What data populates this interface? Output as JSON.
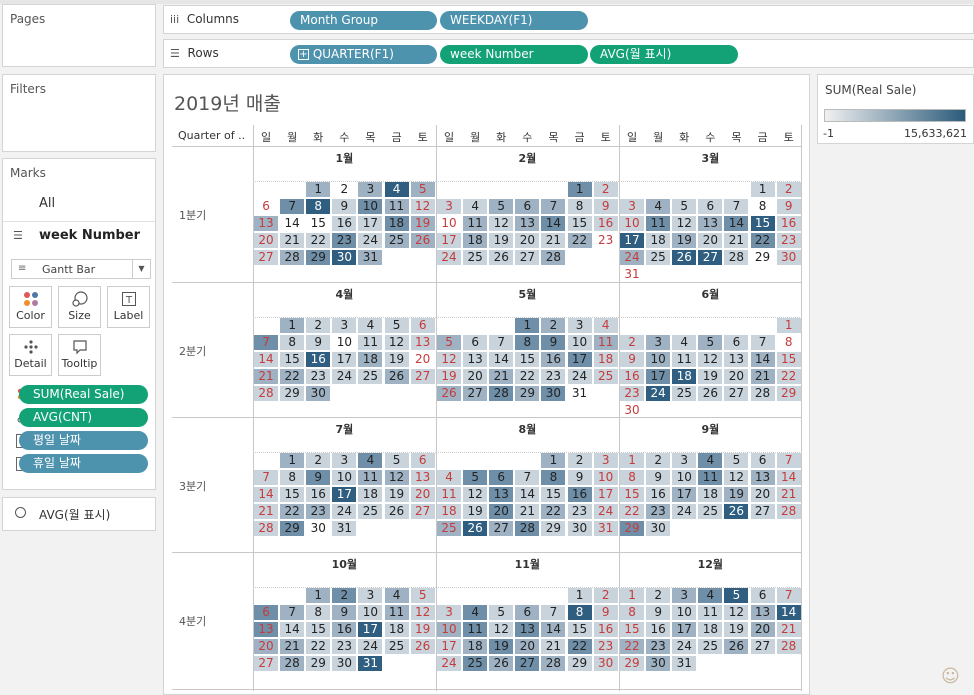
{
  "left_panel": {
    "pages_title": "Pages",
    "filters_title": "Filters",
    "marks_title": "Marks",
    "marks_all": "All",
    "marks_selected": "week Number",
    "mark_type": "Gantt Bar",
    "buttons": {
      "color": "Color",
      "size": "Size",
      "label": "Label",
      "detail": "Detail",
      "tooltip": "Tooltip"
    },
    "fields": [
      "SUM(Real Sale)",
      "AVG(CNT)",
      "평일 날짜",
      "휴일 날짜"
    ],
    "avg_field": "AVG(월 표시)"
  },
  "shelves": {
    "columns_label": "Columns",
    "rows_label": "Rows",
    "columns": [
      "Month Group",
      "WEEKDAY(F1)"
    ],
    "rows": [
      "QUARTER(F1)",
      "week Number",
      "AVG(월 표시)"
    ]
  },
  "view": {
    "title": "2019년 매출",
    "quarter_header": "Quarter of ..",
    "weekdays": [
      "일",
      "월",
      "화",
      "수",
      "목",
      "금",
      "토"
    ],
    "quarters": [
      "1분기",
      "2분기",
      "3분기",
      "4분기"
    ],
    "month_names": [
      "1월",
      "2월",
      "3월",
      "4월",
      "5월",
      "6월",
      "7월",
      "8월",
      "9월",
      "10월",
      "11월",
      "12월"
    ]
  },
  "legend": {
    "title": "SUM(Real Sale)",
    "min": "-1",
    "max": "15,633,621",
    "color_low": "#f0f0f0",
    "color_high": "#2b5b7b"
  },
  "colors": {
    "sunday_red": "#c63b3b",
    "pill_green": "#12a276",
    "pill_blue": "#4e93ad"
  },
  "month_shades": {
    "1": [
      0,
      0,
      2,
      0,
      2,
      4,
      2,
      0,
      3,
      4,
      1,
      3,
      2,
      1,
      2,
      0,
      0,
      1,
      1,
      3,
      2,
      1,
      1,
      1,
      3,
      1,
      2,
      2,
      1,
      2,
      3,
      4,
      2,
      0,
      0
    ],
    "2": [
      0,
      0,
      0,
      0,
      0,
      3,
      1,
      1,
      1,
      2,
      2,
      2,
      1,
      1,
      0,
      2,
      1,
      2,
      3,
      1,
      1,
      1,
      2,
      1,
      1,
      1,
      2,
      0,
      1,
      1,
      1,
      1,
      2,
      0,
      0
    ],
    "3": [
      0,
      0,
      0,
      0,
      0,
      1,
      1,
      1,
      2,
      1,
      1,
      1,
      0,
      1,
      1,
      3,
      1,
      2,
      3,
      4,
      1,
      4,
      1,
      2,
      1,
      1,
      3,
      1,
      2,
      1,
      4,
      4,
      1,
      0,
      1
    ],
    "4": [
      0,
      2,
      1,
      1,
      1,
      1,
      1,
      3,
      1,
      1,
      0,
      1,
      1,
      1,
      1,
      1,
      4,
      1,
      2,
      1,
      0,
      2,
      2,
      1,
      1,
      1,
      2,
      1,
      1,
      1,
      2,
      0,
      0,
      0,
      0
    ],
    "5": [
      0,
      0,
      0,
      3,
      2,
      1,
      1,
      2,
      1,
      1,
      3,
      3,
      1,
      2,
      1,
      1,
      1,
      1,
      2,
      3,
      1,
      1,
      1,
      2,
      1,
      1,
      1,
      1,
      2,
      2,
      3,
      2,
      3,
      0,
      0
    ],
    "6": [
      0,
      0,
      0,
      0,
      0,
      0,
      1,
      1,
      2,
      1,
      2,
      1,
      1,
      0,
      1,
      2,
      1,
      1,
      1,
      2,
      1,
      1,
      3,
      4,
      1,
      1,
      2,
      1,
      1,
      4,
      1,
      1,
      1,
      1,
      1
    ],
    "7": [
      0,
      2,
      1,
      1,
      3,
      1,
      1,
      1,
      1,
      3,
      1,
      2,
      2,
      1,
      1,
      1,
      1,
      4,
      1,
      1,
      1,
      1,
      2,
      2,
      1,
      1,
      1,
      1,
      1,
      3,
      0,
      1,
      0,
      0,
      0
    ],
    "8": [
      0,
      0,
      0,
      0,
      2,
      1,
      1,
      1,
      3,
      3,
      1,
      3,
      1,
      1,
      1,
      1,
      3,
      1,
      1,
      3,
      1,
      1,
      1,
      3,
      1,
      2,
      1,
      1,
      2,
      4,
      2,
      3,
      1,
      1,
      1
    ],
    "9": [
      1,
      1,
      1,
      3,
      1,
      1,
      1,
      1,
      1,
      1,
      3,
      1,
      2,
      1,
      1,
      1,
      2,
      1,
      2,
      1,
      1,
      1,
      2,
      1,
      1,
      4,
      1,
      1,
      3,
      1,
      0,
      0,
      0,
      0,
      0
    ],
    "10": [
      0,
      0,
      2,
      3,
      1,
      2,
      1,
      3,
      2,
      1,
      2,
      1,
      2,
      1,
      3,
      1,
      1,
      2,
      4,
      1,
      1,
      2,
      2,
      1,
      1,
      1,
      1,
      1,
      1,
      2,
      1,
      1,
      4,
      0,
      0
    ],
    "11": [
      0,
      0,
      0,
      0,
      0,
      1,
      1,
      1,
      3,
      1,
      2,
      1,
      4,
      1,
      2,
      3,
      1,
      3,
      2,
      1,
      1,
      1,
      2,
      3,
      2,
      1,
      3,
      1,
      1,
      3,
      2,
      3,
      2,
      1,
      1
    ],
    "12": [
      1,
      1,
      2,
      3,
      4,
      1,
      1,
      1,
      1,
      1,
      1,
      1,
      2,
      4,
      1,
      1,
      2,
      1,
      1,
      2,
      1,
      2,
      2,
      1,
      1,
      2,
      1,
      1,
      1,
      2,
      1,
      1,
      0,
      0,
      0
    ]
  }
}
